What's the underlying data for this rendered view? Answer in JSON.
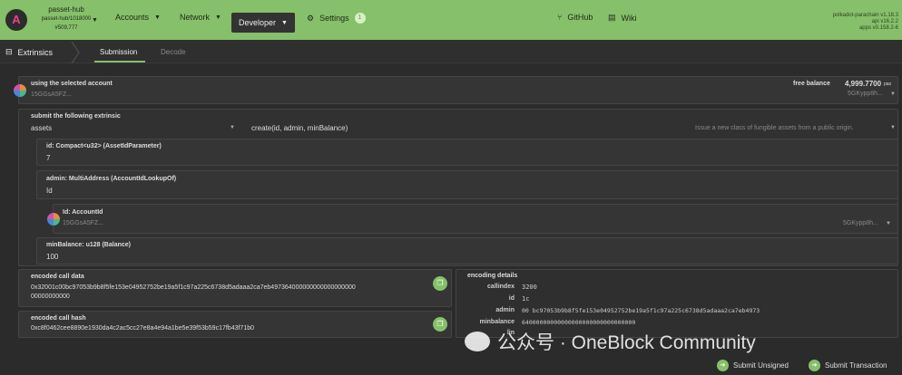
{
  "chain": {
    "name": "passet-hub",
    "network": "passet-hub/1018000",
    "block": "#509,777"
  },
  "nav": {
    "accounts": "Accounts",
    "network": "Network",
    "developer": "Developer",
    "settings": "Settings",
    "settings_badge": "1",
    "github": "GitHub",
    "wiki": "Wiki"
  },
  "versions": [
    "polkadot-parachain v1.18.3",
    "api v16.2.2",
    "apps v0.158.2-6"
  ],
  "tabs": {
    "section": "Extrinsics",
    "submission": "Submission",
    "decode": "Decode"
  },
  "account": {
    "label": "using the selected account",
    "value": "15GGsA5FZ...",
    "balance_label": "free balance",
    "balance_value": "4,999.7700",
    "balance_unit": "pas",
    "right_addr": "5GKypp8h..."
  },
  "extrinsic": {
    "label": "submit the following extrinsic",
    "pallet": "assets",
    "call": "create(id, admin, minBalance)",
    "desc": "Issue a new class of fungible assets from a public origin."
  },
  "params": {
    "id_label": "id: Compact<u32> (AssetIdParameter)",
    "id_value": "7",
    "admin_label": "admin: MultiAddress (AccountIdLookupOf)",
    "admin_value": "Id",
    "accountid_label": "Id: AccountId",
    "accountid_value": "15GGsA5FZ...",
    "accountid_right": "5GKypp8h...",
    "minbal_label": "minBalance: u128 (Balance)",
    "minbal_value": "100"
  },
  "encoded_call": {
    "label": "encoded call data",
    "value_line1": "0x32001c00bc97053b9b8f5fe153e04952752be19a5f1c97a225c6738d5adaaa2ca7eb497364000000000000000000",
    "value_line2": "00000000000"
  },
  "encoded_hash": {
    "label": "encoded call hash",
    "value": "0xc8f0462cee8890e1930da4c2ac5cc27e8a4e94a1be5e39f53b59c17fb43f71b0"
  },
  "details": {
    "label": "encoding details",
    "callindex_k": "callindex",
    "callindex_v": "3200",
    "id_k": "id",
    "id_v": "1c",
    "admin_k": "admin",
    "admin_v": "00 bc97053b9b8f5fe153e04952752be19a5f1c97a225c6738d5adaaa2ca7eb4973",
    "minbalance_k": "minbalance",
    "minbalance_v": "64000000000000000000000000000000",
    "link_k": "lin"
  },
  "actions": {
    "unsigned": "Submit Unsigned",
    "transaction": "Submit Transaction"
  },
  "watermark": {
    "text": "公众号 · OneBlock Community"
  },
  "colors": {
    "accent": "#86c06a",
    "bg": "#2b2b2b",
    "panel": "#353535"
  }
}
